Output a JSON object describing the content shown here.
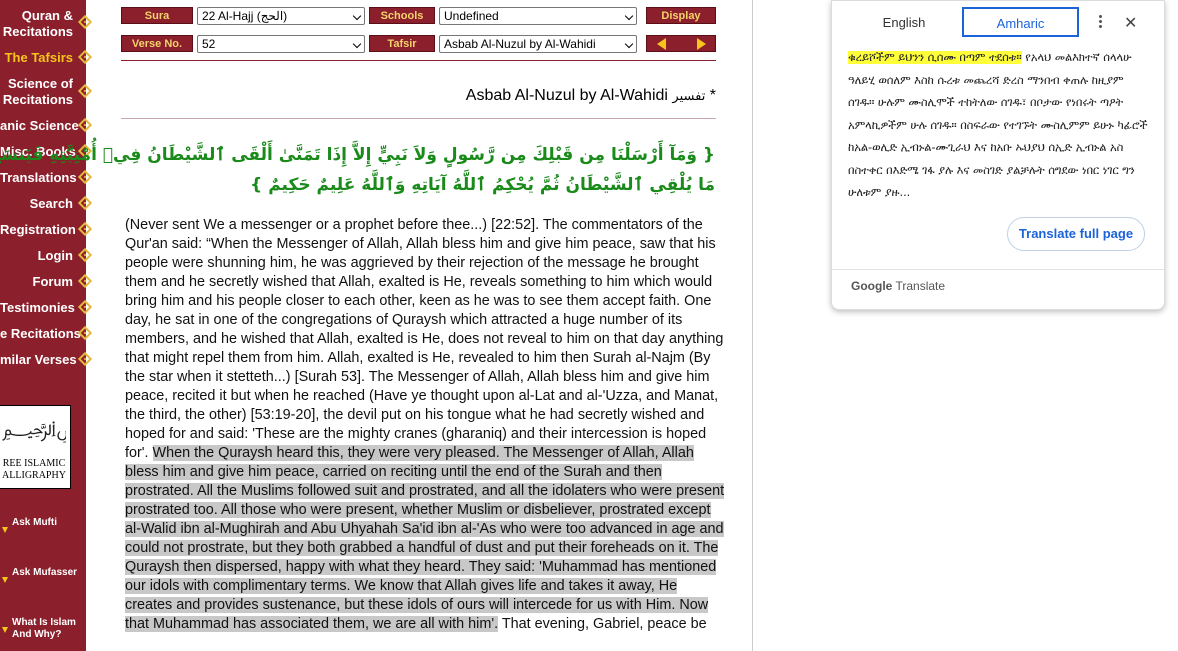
{
  "sidebar": {
    "items": [
      {
        "label": "Quran &",
        "label2": "Recitations",
        "active": false
      },
      {
        "label": "The Tafsirs",
        "active": true
      },
      {
        "label": "Science of",
        "label2": "Recitations",
        "active": false
      },
      {
        "label": "anic Science",
        "active": false
      },
      {
        "label": "Misc. Books",
        "active": false
      },
      {
        "label": "Translations",
        "active": false
      },
      {
        "label": "Search",
        "active": false
      },
      {
        "label": "Registration",
        "active": false
      },
      {
        "label": "Login",
        "active": false
      },
      {
        "label": "Forum",
        "active": false
      },
      {
        "label": "Testimonies",
        "active": false
      },
      {
        "label": "e Recitations",
        "active": false
      },
      {
        "label": "milar Verses",
        "active": false
      }
    ],
    "calligraphy": {
      "line1": "REE ISLAMIC",
      "line2": "ALLIGRAPHY"
    },
    "links": [
      "Ask Mufti",
      "Ask Mufasser",
      "What Is Islam",
      "And Why?"
    ]
  },
  "controls": {
    "sura_label": "Sura",
    "sura_value": "22  Al-Hajj  (الحج)",
    "schools_label": "Schools",
    "schools_value": "Undefined",
    "display_label": "Display",
    "verse_label": "Verse No.",
    "verse_value": "52",
    "tafsir_label": "Tafsir",
    "tafsir_value": "Asbab Al-Nuzul by Al-Wahidi"
  },
  "content": {
    "tafsir_title": "Asbab Al-Nuzul by Al-Wahidi",
    "tafsir_title_ar": "تفسير",
    "asterisk": "*",
    "verse_line1": "{ وَمَآ أَرْسَلْنَا مِن قَبْلِكَ مِن رَّسُولٍ وَلاَ نَبِيٍّ إِلاَّ إِذَا تَمَنَّىٰ أَلْقَى ٱلشَّيْطَانُ فِيۤ أُمْنِيَّتِهِ فَيَنسَخُ ٱللَّهُ",
    "verse_line2": "مَا يُلْقِي ٱلشَّيْطَانُ ثُمَّ يُحْكِمُ ٱللَّهُ آيَاتِهِ وَٱللَّهُ عَلِيمٌ حَكِيمٌ }",
    "body_plain": "(Never sent We a messenger or a prophet before thee...) [22:52]. The commentators of the Qur'an said: “When the Messenger of Allah, Allah bless him and give him peace, saw that his people were shunning him, he was aggrieved by their rejection of the message he brought them and he secretly wished that Allah, exalted is He, reveals something to him which would bring him and his people closer to each other, keen as he was to see them accept faith. One day, he sat in one of the congregations of Quraysh which attracted a huge number of its members, and he wished that Allah, exalted is He, does not reveal to him on that day anything that might repel them from him. Allah, exalted is He, revealed to him then Surah al-Najm (By the star when it stetteth...) [Surah 53]. The Messenger of Allah, Allah bless him and give him peace, recited it but when he reached (Have ye thought upon al-Lat and al-'Uzza, and Manat, the third, the other) [53:19-20], the devil put on his tongue what he had secretly wished and hoped for and said: 'These are the mighty cranes (gharaniq) and their intercession is hoped for'. ",
    "body_highlight": "When the Quraysh heard this, they were very pleased. The Messenger of Allah, Allah bless him and give him peace, carried on reciting until the end of the Surah and then prostrated. All the Muslims followed suit and prostrated, and all the idolaters who were present prostrated too. All those who were present, whether Muslim or disbeliever, prostrated except al-Walid ibn al-Mughirah and Abu Uhyahah Sa'id ibn al-'As who were too advanced in age and could not prostrate, but they both grabbed a handful of dust and put their foreheads on it. The Quraysh then dispersed, happy with what they heard. They said: 'Muhammad has mentioned our idols with complimentary terms. We know that Allah gives life and takes it away, He creates and provides sustenance, but these idols of ours will intercede for us with Him. Now that Muhammad has associated them, we are all with him'.",
    "body_tail": " That evening, Gabriel, peace be"
  },
  "translate_popup": {
    "tab_source": "English",
    "tab_target": "Amharic",
    "translation_highlight": "ቁረይሾችም ይህንን ሲሰሙ በጣም ተደሰቱ።",
    "translation_rest": " የአላህ መልእክተኛ ሰላላሁ ዓለይሂ ወሰለም እስከ ሱረቱ መጨረሻ ድረስ ማንበብ ቀጠሉ ከዚያም ሰገዱ። ሁሉም ሙስሊሞች ተከትለው ሰገዱ፣ በቦታው የነበሩት ጣዖት አምላኪዎችም ሁሉ ሰገዱ። በስፍራው የተገኙት ሙስሊምም ይሁኑ ካፊሮች ከአል-ወሊድ ኢብኑል-ሙጊራህ እና ከአቡ ኡህያህ ሰኢድ ኢብኑል አስ በስተቀር በእድሜ ገፋ ያሉ እና መስገድ ያልቻሉት ሰግደው ነበር ነገር ግን ሁለቱም ያዙ...",
    "full_page_button": "Translate full page",
    "footer_brand": "Google",
    "footer_product": " Translate"
  },
  "colors": {
    "maroon": "#8b1f2c",
    "gold": "#f6c51a",
    "verse_green": "#1a8a1a",
    "link_blue": "#1a63d8",
    "highlight_yellow": "#ffff3a",
    "selection_gray": "#c8c8c8"
  }
}
